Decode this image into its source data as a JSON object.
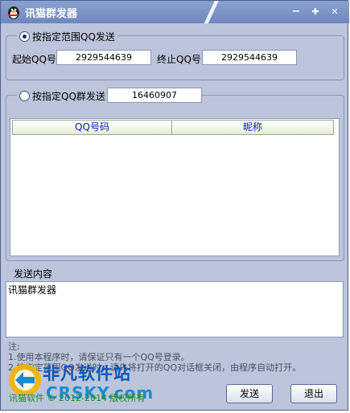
{
  "window": {
    "title": "讯猫群发器",
    "buttons": {
      "minimize": "−",
      "maximize": "✚",
      "close": "✕"
    }
  },
  "range_group": {
    "radio_label": "按指定范围QQ发送",
    "start_label": "起始QQ号",
    "start_value": "2929544639",
    "end_label": "终止QQ号",
    "end_value": "2929544639"
  },
  "group_section": {
    "radio_label": "按指定QQ群发送",
    "group_value": "16460907",
    "columns": [
      "QQ号码",
      "昵称"
    ]
  },
  "message": {
    "label": "发送内容",
    "content": "讯猫群发器"
  },
  "notes": {
    "header": "注:",
    "line1": "1.使用本程序时，请保证只有一个QQ号登录。",
    "line2": "2.按指定范围QQ发送时，请先将打开的QQ对话框关闭，由程序自动打开。"
  },
  "copyright": "讯猫软件 © 2012-2014 版权所有",
  "watermark": {
    "main": "非凡软件站",
    "sub": "CRSKY.com"
  },
  "actions": {
    "send": "发送",
    "exit": "退出"
  }
}
